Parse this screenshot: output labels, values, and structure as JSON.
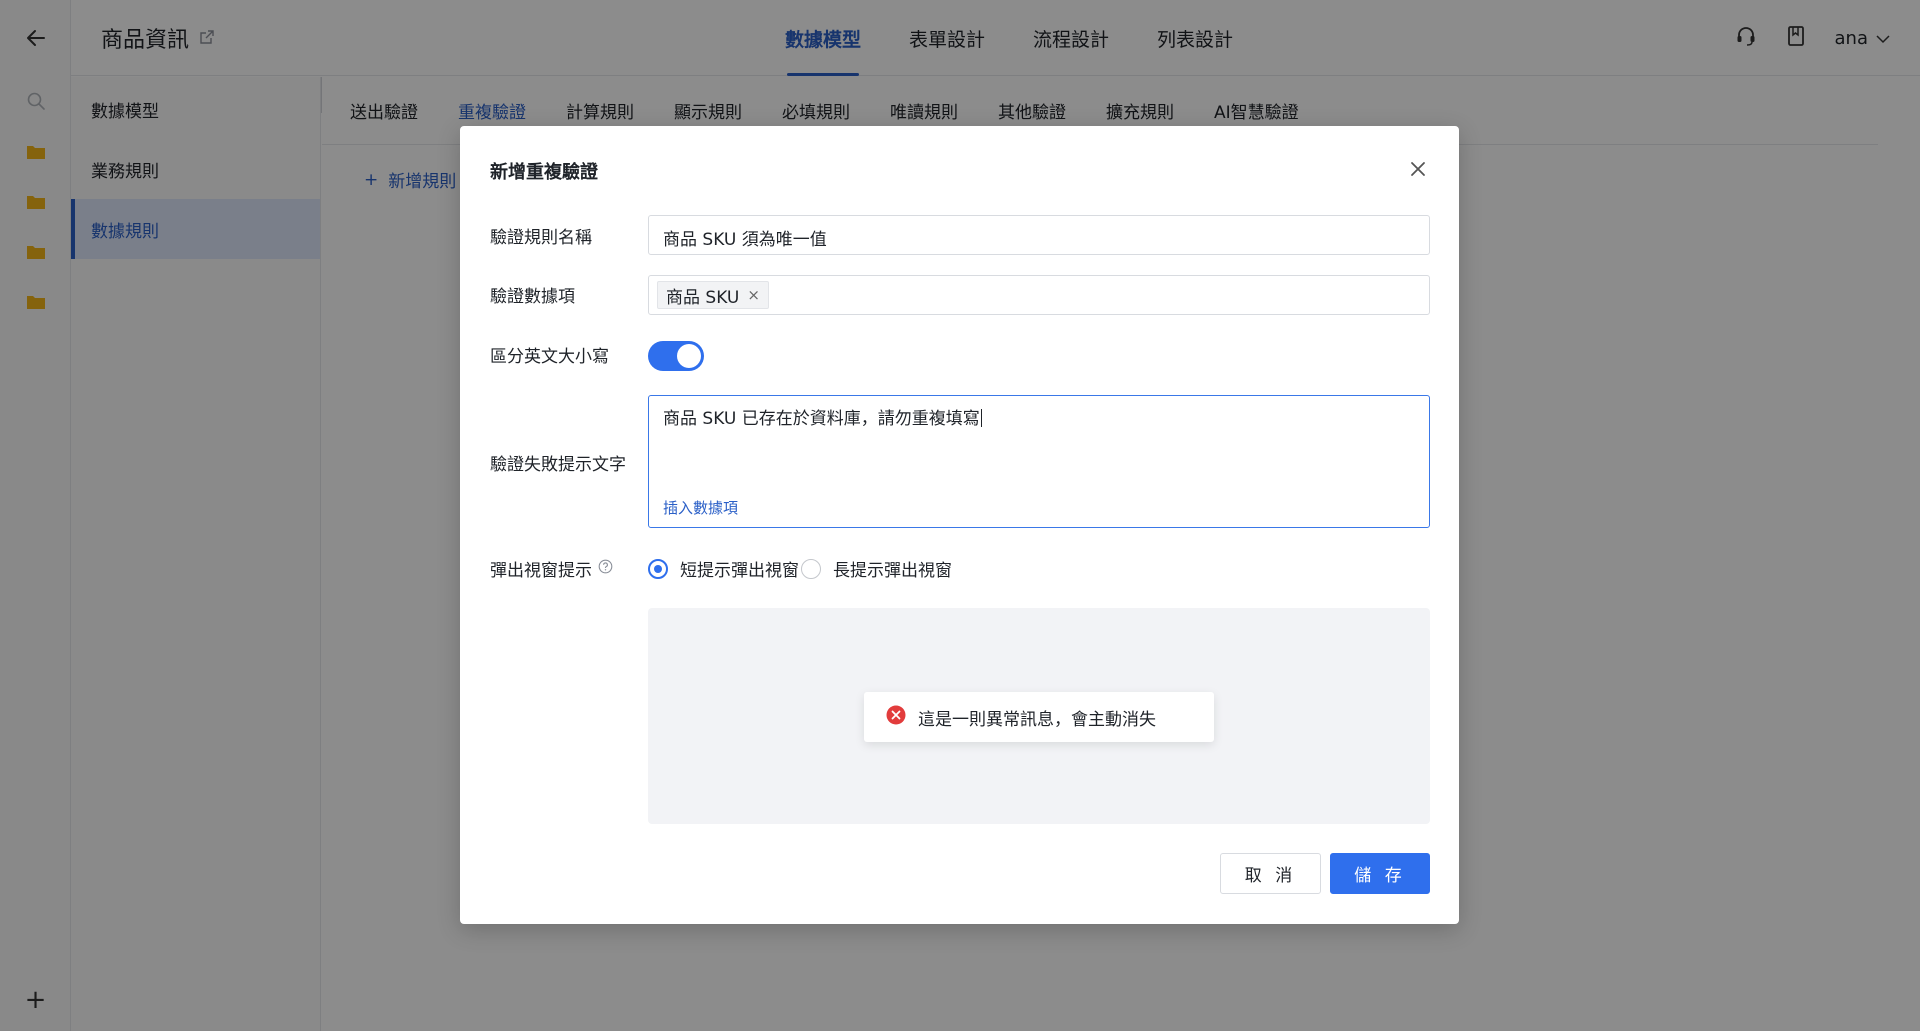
{
  "app": {
    "title": "商品資訊",
    "user": "ana"
  },
  "top_tabs": [
    {
      "label": "數據模型",
      "active": true
    },
    {
      "label": "表單設計",
      "active": false
    },
    {
      "label": "流程設計",
      "active": false
    },
    {
      "label": "列表設計",
      "active": false
    }
  ],
  "sidebar": {
    "items": [
      {
        "label": "數據模型",
        "active": false
      },
      {
        "label": "業務規則",
        "active": false
      },
      {
        "label": "數據規則",
        "active": true
      }
    ]
  },
  "rule_tabs": [
    {
      "label": "送出驗證",
      "active": false
    },
    {
      "label": "重複驗證",
      "active": true
    },
    {
      "label": "計算規則",
      "active": false
    },
    {
      "label": "顯示規則",
      "active": false
    },
    {
      "label": "必填規則",
      "active": false
    },
    {
      "label": "唯讀規則",
      "active": false
    },
    {
      "label": "其他驗證",
      "active": false
    },
    {
      "label": "擴充規則",
      "active": false
    },
    {
      "label": "AI智慧驗證",
      "active": false
    }
  ],
  "add_rule_label": "新增規則",
  "dialog": {
    "title": "新增重複驗證",
    "fields": {
      "rule_name": {
        "label": "驗證規則名稱",
        "value": "商品 SKU 須為唯一值"
      },
      "data_item": {
        "label": "驗證數據項",
        "tags": [
          "商品 SKU"
        ]
      },
      "case_sensitive": {
        "label": "區分英文大小寫",
        "on": true
      },
      "fail_text": {
        "label": "驗證失敗提示文字",
        "value": "商品 SKU 已存在於資料庫，請勿重複填寫",
        "insert_link": "插入數據項"
      },
      "popup": {
        "label": "彈出視窗提示",
        "options": [
          {
            "label": "短提示彈出視窗",
            "checked": true
          },
          {
            "label": "長提示彈出視窗",
            "checked": false
          }
        ]
      }
    },
    "preview_toast": "這是一則異常訊息，會主動消失",
    "buttons": {
      "cancel": "取 消",
      "save": "儲 存"
    }
  },
  "colors": {
    "accent": "#2f6fed",
    "active_text": "#2a5fc7",
    "error": "#e23c3c",
    "folder": "#f2b418"
  }
}
